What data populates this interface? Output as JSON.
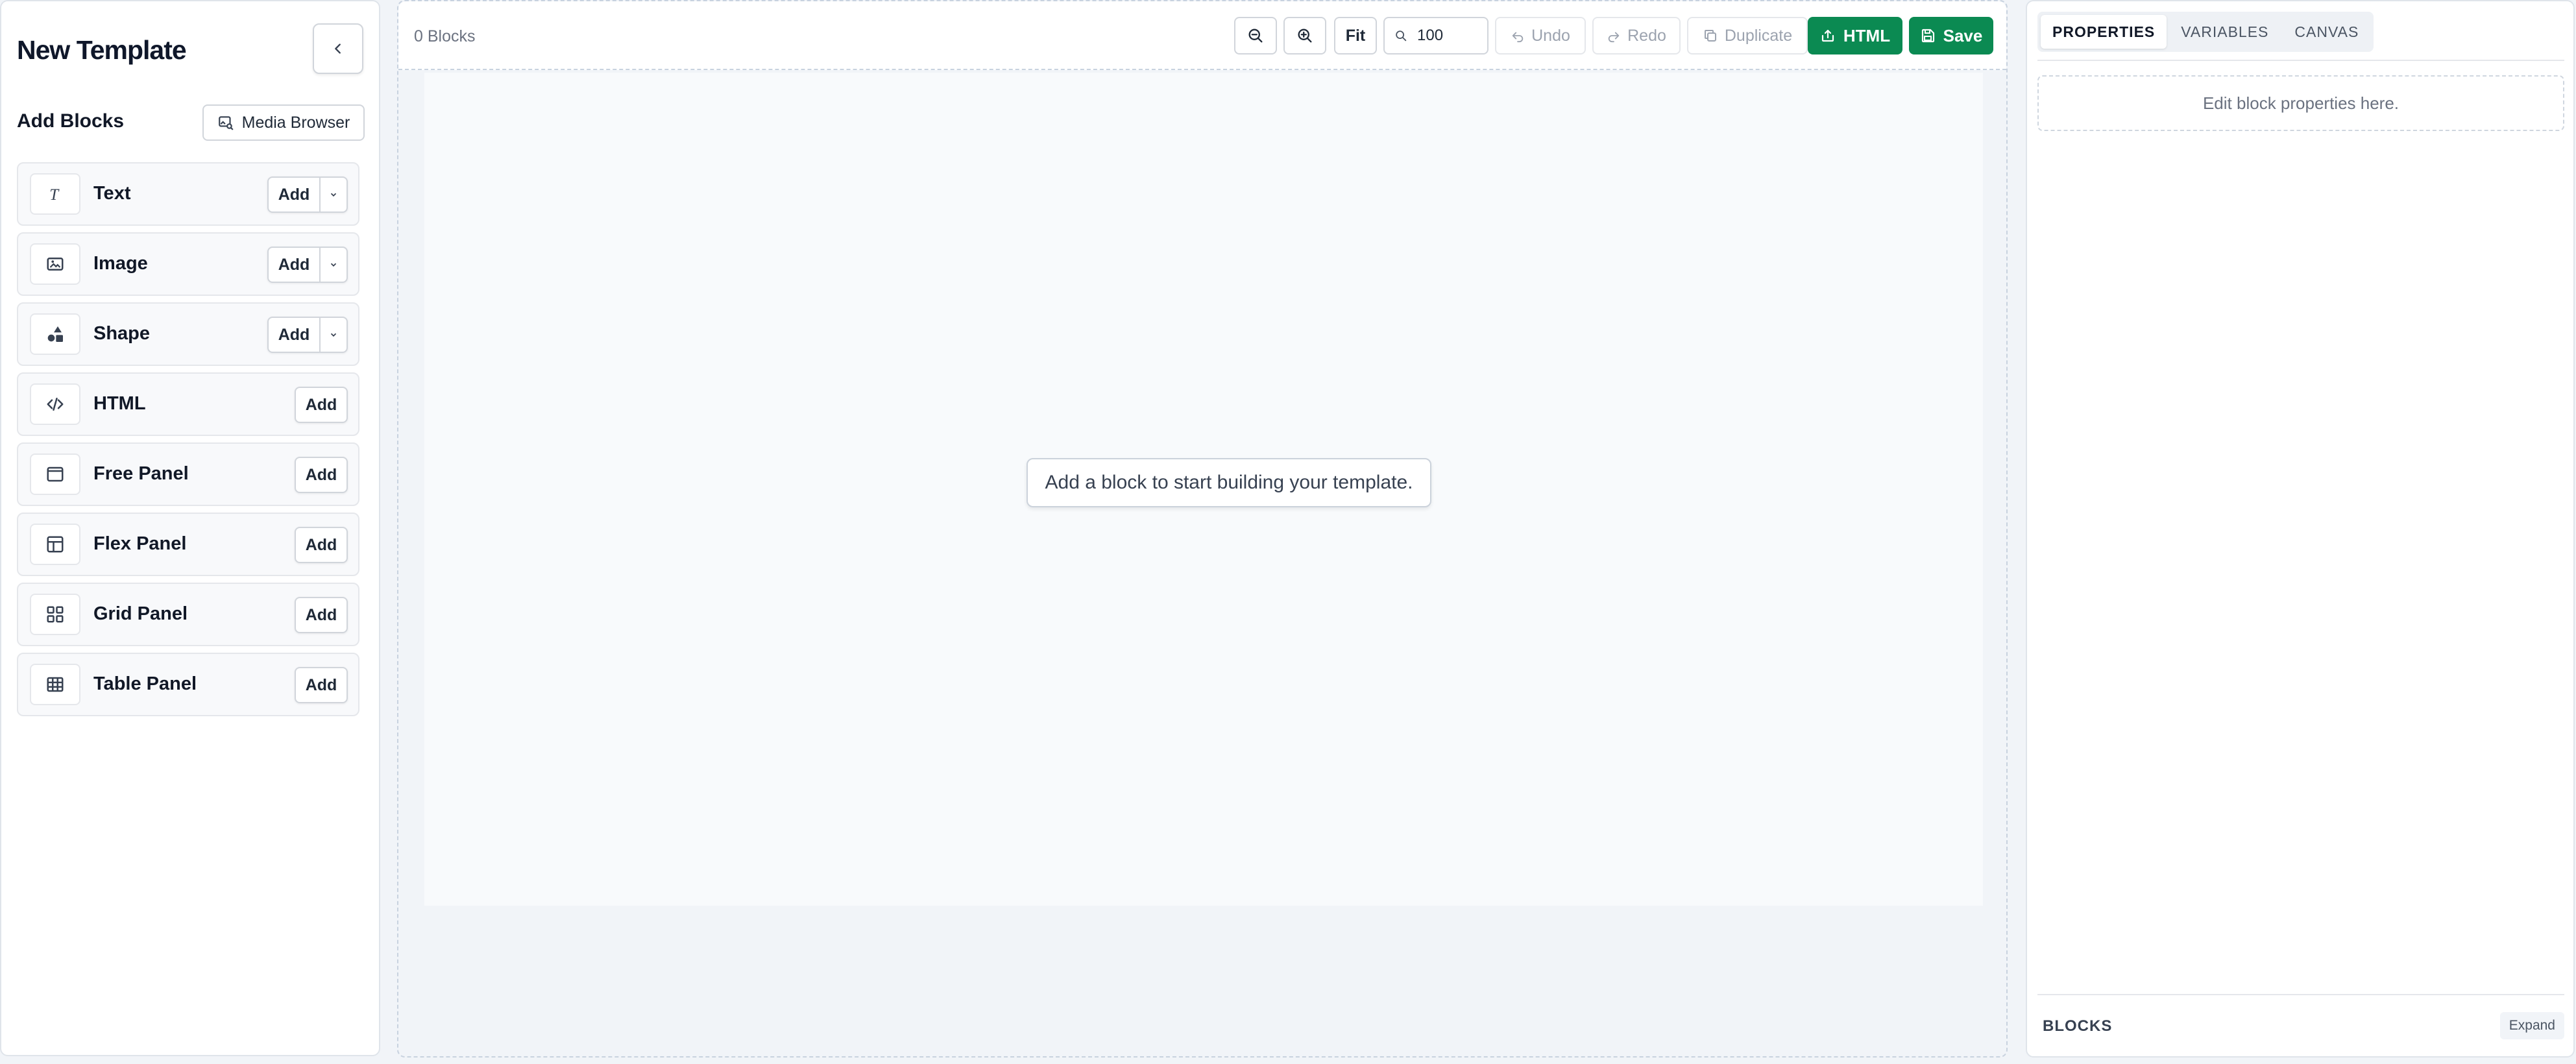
{
  "sidebar": {
    "title": "New Template",
    "collapse_icon": "chevron-left-icon",
    "section_title": "Add Blocks",
    "media_browser_label": "Media Browser",
    "blocks": [
      {
        "label": "Text",
        "add_label": "Add",
        "has_dropdown": true,
        "icon": "text-icon"
      },
      {
        "label": "Image",
        "add_label": "Add",
        "has_dropdown": true,
        "icon": "image-icon"
      },
      {
        "label": "Shape",
        "add_label": "Add",
        "has_dropdown": true,
        "icon": "shapes-icon"
      },
      {
        "label": "HTML",
        "add_label": "Add",
        "has_dropdown": false,
        "icon": "code-icon"
      },
      {
        "label": "Free Panel",
        "add_label": "Add",
        "has_dropdown": false,
        "icon": "window-icon"
      },
      {
        "label": "Flex Panel",
        "add_label": "Add",
        "has_dropdown": false,
        "icon": "layout-icon"
      },
      {
        "label": "Grid Panel",
        "add_label": "Add",
        "has_dropdown": false,
        "icon": "grid-icon"
      },
      {
        "label": "Table Panel",
        "add_label": "Add",
        "has_dropdown": false,
        "icon": "table-icon"
      }
    ]
  },
  "toolbar": {
    "block_count": "0 Blocks",
    "fit_label": "Fit",
    "zoom_value": "100",
    "undo_label": "Undo",
    "redo_label": "Redo",
    "duplicate_label": "Duplicate",
    "html_label": "HTML",
    "save_label": "Save"
  },
  "canvas": {
    "empty_hint": "Add a block to start building your template."
  },
  "right_panel": {
    "tabs": [
      "PROPERTIES",
      "VARIABLES",
      "CANVAS"
    ],
    "active_tab": "PROPERTIES",
    "properties_placeholder": "Edit block properties here.",
    "blocks_label": "BLOCKS",
    "expand_label": "Expand"
  },
  "colors": {
    "accent_green": "#0b8a52",
    "canvas_bg": "#f1f4f8"
  }
}
